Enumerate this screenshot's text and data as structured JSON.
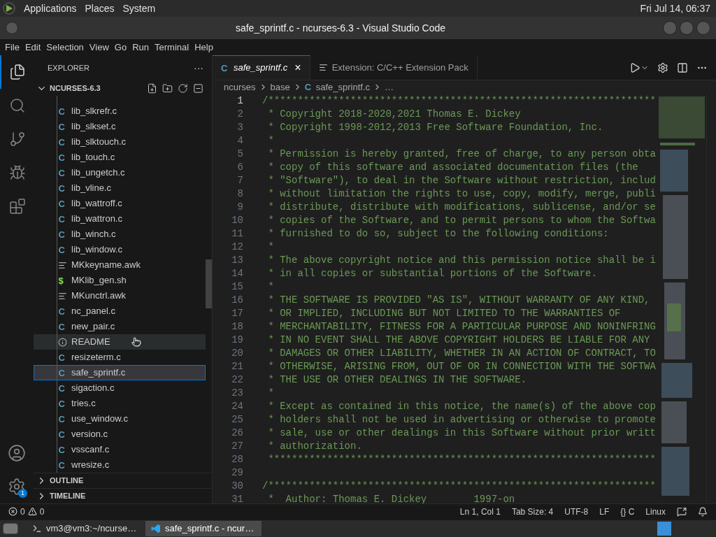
{
  "top_panel": {
    "menus": [
      "Applications",
      "Places",
      "System"
    ],
    "clock": "Fri Jul 14, 06:37"
  },
  "window": {
    "title": "safe_sprintf.c - ncurses-6.3 - Visual Studio Code"
  },
  "menu_bar": [
    "File",
    "Edit",
    "Selection",
    "View",
    "Go",
    "Run",
    "Terminal",
    "Help"
  ],
  "activity_bar": {
    "items": [
      {
        "kind": "files",
        "selected": true
      },
      {
        "kind": "search",
        "selected": false
      },
      {
        "kind": "branch",
        "selected": false
      },
      {
        "kind": "debug",
        "selected": false
      },
      {
        "kind": "extensions",
        "selected": false
      }
    ],
    "settings_badge": "1"
  },
  "sidebar": {
    "title": "EXPLORER",
    "more": "···",
    "folder": {
      "name": "NCURSES-6.3",
      "expanded": true
    },
    "files": [
      {
        "name": "lib_slkrefr.c",
        "kind": "c",
        "icon": "C",
        "selected": false,
        "hovered": false
      },
      {
        "name": "lib_slkset.c",
        "kind": "c",
        "icon": "C",
        "selected": false,
        "hovered": false
      },
      {
        "name": "lib_slktouch.c",
        "kind": "c",
        "icon": "C",
        "selected": false,
        "hovered": false
      },
      {
        "name": "lib_touch.c",
        "kind": "c",
        "icon": "C",
        "selected": false,
        "hovered": false
      },
      {
        "name": "lib_ungetch.c",
        "kind": "c",
        "icon": "C",
        "selected": false,
        "hovered": false
      },
      {
        "name": "lib_vline.c",
        "kind": "c",
        "icon": "C",
        "selected": false,
        "hovered": false
      },
      {
        "name": "lib_wattroff.c",
        "kind": "c",
        "icon": "C",
        "selected": false,
        "hovered": false
      },
      {
        "name": "lib_wattron.c",
        "kind": "c",
        "icon": "C",
        "selected": false,
        "hovered": false
      },
      {
        "name": "lib_winch.c",
        "kind": "c",
        "icon": "C",
        "selected": false,
        "hovered": false
      },
      {
        "name": "lib_window.c",
        "kind": "c",
        "icon": "C",
        "selected": false,
        "hovered": false
      },
      {
        "name": "MKkeyname.awk",
        "kind": "text",
        "selected": false,
        "hovered": false
      },
      {
        "name": "MKlib_gen.sh",
        "kind": "shell",
        "icon": "$",
        "selected": false,
        "hovered": false
      },
      {
        "name": "MKunctrl.awk",
        "kind": "text",
        "selected": false,
        "hovered": false
      },
      {
        "name": "nc_panel.c",
        "kind": "c",
        "icon": "C",
        "selected": false,
        "hovered": false
      },
      {
        "name": "new_pair.c",
        "kind": "c",
        "icon": "C",
        "selected": false,
        "hovered": false
      },
      {
        "name": "README",
        "kind": "info",
        "selected": false,
        "hovered": true
      },
      {
        "name": "resizeterm.c",
        "kind": "c",
        "icon": "C",
        "selected": false,
        "hovered": false
      },
      {
        "name": "safe_sprintf.c",
        "kind": "c",
        "icon": "C",
        "selected": true,
        "hovered": false
      },
      {
        "name": "sigaction.c",
        "kind": "c",
        "icon": "C",
        "selected": false,
        "hovered": false
      },
      {
        "name": "tries.c",
        "kind": "c",
        "icon": "C",
        "selected": false,
        "hovered": false
      },
      {
        "name": "use_window.c",
        "kind": "c",
        "icon": "C",
        "selected": false,
        "hovered": false
      },
      {
        "name": "version.c",
        "kind": "c",
        "icon": "C",
        "selected": false,
        "hovered": false
      },
      {
        "name": "vsscanf.c",
        "kind": "c",
        "icon": "C",
        "selected": false,
        "hovered": false
      },
      {
        "name": "wresize.c",
        "kind": "c",
        "icon": "C",
        "selected": false,
        "hovered": false
      }
    ],
    "sections": [
      {
        "name": "OUTLINE",
        "expanded": false
      },
      {
        "name": "TIMELINE",
        "expanded": false
      }
    ]
  },
  "tabs": [
    {
      "label": "safe_sprintf.c",
      "kind": "c",
      "icon": "C",
      "selected": true,
      "preview": true,
      "close": "×"
    },
    {
      "label": "Extension: C/C++ Extension Pack",
      "kind": "text",
      "selected": false,
      "preview": false
    }
  ],
  "breadcrumbs": [
    {
      "label": "ncurses"
    },
    {
      "label": "base"
    },
    {
      "label": "safe_sprintf.c",
      "icon": "C"
    },
    {
      "label": "…"
    }
  ],
  "code": [
    {
      "number": "1",
      "text": "/******************************************************************",
      "current": true
    },
    {
      "number": "2",
      "text": " * Copyright 2018-2020,2021 Thomas E. Dickey",
      "current": false
    },
    {
      "number": "3",
      "text": " * Copyright 1998-2012,2013 Free Software Foundation, Inc.",
      "current": false
    },
    {
      "number": "4",
      "text": " *",
      "current": false
    },
    {
      "number": "5",
      "text": " * Permission is hereby granted, free of charge, to any person obta",
      "current": false
    },
    {
      "number": "6",
      "text": " * copy of this software and associated documentation files (the",
      "current": false
    },
    {
      "number": "7",
      "text": " * \"Software\"), to deal in the Software without restriction, includ",
      "current": false
    },
    {
      "number": "8",
      "text": " * without limitation the rights to use, copy, modify, merge, publi",
      "current": false
    },
    {
      "number": "9",
      "text": " * distribute, distribute with modifications, sublicense, and/or se",
      "current": false
    },
    {
      "number": "10",
      "text": " * copies of the Software, and to permit persons to whom the Softwa",
      "current": false
    },
    {
      "number": "11",
      "text": " * furnished to do so, subject to the following conditions:",
      "current": false
    },
    {
      "number": "12",
      "text": " *",
      "current": false
    },
    {
      "number": "13",
      "text": " * The above copyright notice and this permission notice shall be i",
      "current": false
    },
    {
      "number": "14",
      "text": " * in all copies or substantial portions of the Software.",
      "current": false
    },
    {
      "number": "15",
      "text": " *",
      "current": false
    },
    {
      "number": "16",
      "text": " * THE SOFTWARE IS PROVIDED \"AS IS\", WITHOUT WARRANTY OF ANY KIND,",
      "current": false
    },
    {
      "number": "17",
      "text": " * OR IMPLIED, INCLUDING BUT NOT LIMITED TO THE WARRANTIES OF",
      "current": false
    },
    {
      "number": "18",
      "text": " * MERCHANTABILITY, FITNESS FOR A PARTICULAR PURPOSE AND NONINFRING",
      "current": false
    },
    {
      "number": "19",
      "text": " * IN NO EVENT SHALL THE ABOVE COPYRIGHT HOLDERS BE LIABLE FOR ANY",
      "current": false
    },
    {
      "number": "20",
      "text": " * DAMAGES OR OTHER LIABILITY, WHETHER IN AN ACTION OF CONTRACT, TO",
      "current": false
    },
    {
      "number": "21",
      "text": " * OTHERWISE, ARISING FROM, OUT OF OR IN CONNECTION WITH THE SOFTWA",
      "current": false
    },
    {
      "number": "22",
      "text": " * THE USE OR OTHER DEALINGS IN THE SOFTWARE.",
      "current": false
    },
    {
      "number": "23",
      "text": " *",
      "current": false
    },
    {
      "number": "24",
      "text": " * Except as contained in this notice, the name(s) of the above cop",
      "current": false
    },
    {
      "number": "25",
      "text": " * holders shall not be used in advertising or otherwise to promote",
      "current": false
    },
    {
      "number": "26",
      "text": " * sale, use or other dealings in this Software without prior writt",
      "current": false
    },
    {
      "number": "27",
      "text": " * authorization.",
      "current": false
    },
    {
      "number": "28",
      "text": " ******************************************************************",
      "current": false
    },
    {
      "number": "29",
      "current": false
    },
    {
      "number": "30",
      "text": "/******************************************************************",
      "current": false
    },
    {
      "number": "31",
      "text": " *  Author: Thomas E. Dickey        1997-on",
      "current": false
    }
  ],
  "status_bar": {
    "errors": "0",
    "warnings": "0",
    "items": [
      "Ln 1, Col 1",
      "Tab Size: 4",
      "UTF-8",
      "LF",
      "{} C",
      "Linux"
    ]
  },
  "taskbar": [
    {
      "label": "vm3@vm3:~/ncurse…",
      "kind": "terminal",
      "selected": false
    },
    {
      "label": "safe_sprintf.c - ncur…",
      "kind": "vscode",
      "selected": true
    }
  ]
}
